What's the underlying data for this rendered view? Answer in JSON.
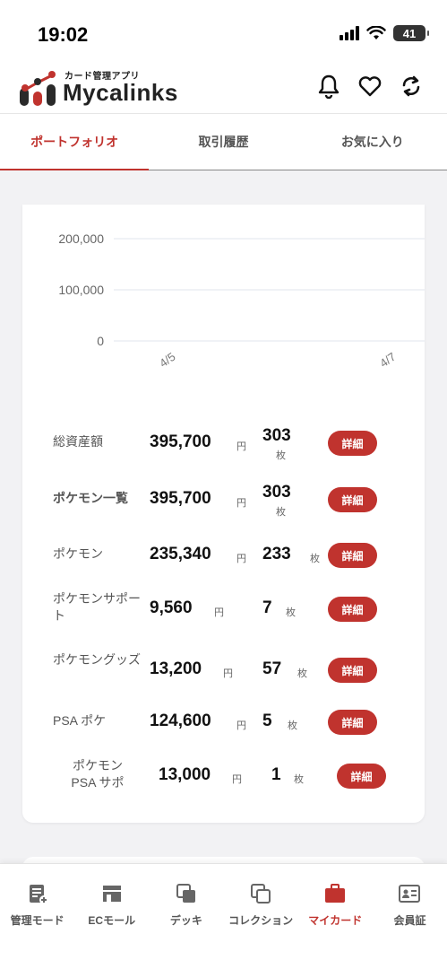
{
  "status_bar": {
    "time": "19:02",
    "battery": "41"
  },
  "header": {
    "logo_sub": "カード管理アプリ",
    "logo_text": "Mycalinks"
  },
  "tabs": [
    {
      "label": "ポートフォリオ",
      "active": true
    },
    {
      "label": "取引履歴",
      "active": false
    },
    {
      "label": "お気に入り",
      "active": false
    }
  ],
  "chart_data": {
    "type": "line",
    "y_ticks": [
      "200,000",
      "100,000",
      "0"
    ],
    "ylim": [
      0,
      200000
    ],
    "x_ticks": [
      "4/5",
      "4/7"
    ],
    "series": [],
    "grid": true
  },
  "portfolio": {
    "yen_unit": "円",
    "count_unit": "枚",
    "detail_label": "詳細",
    "rows": [
      {
        "label": "総資産額",
        "amount": "395,700",
        "count": "303",
        "bold_label": false
      },
      {
        "label": "ポケモン一覧",
        "amount": "395,700",
        "count": "303",
        "bold_label": true
      },
      {
        "label": "ポケモン",
        "amount": "235,340",
        "count": "233",
        "bold_label": false
      },
      {
        "label": "ポケモンサポート",
        "amount": "9,560",
        "count": "7",
        "bold_label": false
      },
      {
        "label": "ポケモングッズ",
        "amount": "13,200",
        "count": "57",
        "bold_label": false
      },
      {
        "label": "PSA ポケ",
        "amount": "124,600",
        "count": "5",
        "bold_label": false
      },
      {
        "label": "ポケモン PSA サポ",
        "amount": "13,000",
        "count": "1",
        "bold_label": false
      }
    ]
  },
  "bottom_nav": [
    {
      "label": "管理モード",
      "icon": "manage-icon",
      "active": false
    },
    {
      "label": "ECモール",
      "icon": "store-icon",
      "active": false
    },
    {
      "label": "デッキ",
      "icon": "deck-icon",
      "active": false
    },
    {
      "label": "コレクション",
      "icon": "collection-icon",
      "active": false
    },
    {
      "label": "マイカード",
      "icon": "briefcase-icon",
      "active": true
    },
    {
      "label": "会員証",
      "icon": "member-card-icon",
      "active": false
    }
  ],
  "colors": {
    "accent": "#c0332e",
    "grid": "#e2e4ee",
    "logo_dots": "#2a2a2a"
  }
}
